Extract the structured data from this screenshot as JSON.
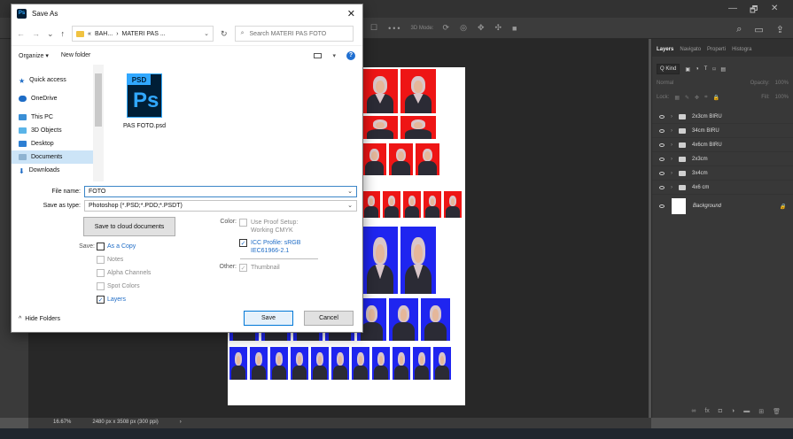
{
  "dialog": {
    "title": "Save As",
    "breadcrumb": {
      "prefix": "«",
      "parts": [
        "BAH...",
        "›",
        "MATERI PAS ..."
      ]
    },
    "search_placeholder": "Search MATERI PAS FOTO",
    "organize_label": "Organize ▾",
    "new_folder_label": "New folder",
    "nav": [
      {
        "label": "Quick access"
      },
      {
        "label": "OneDrive"
      },
      {
        "label": "This PC"
      },
      {
        "label": "3D Objects"
      },
      {
        "label": "Desktop"
      },
      {
        "label": "Documents"
      },
      {
        "label": "Downloads"
      }
    ],
    "file": {
      "name": "PAS FOTO.psd",
      "icon_tag": "PSD",
      "icon_text": "Ps"
    },
    "file_name_label": "File name:",
    "file_name_value": "FOTO",
    "save_as_type_label": "Save as type:",
    "save_as_type_value": "Photoshop (*.PSD;*.PDD;*.PSDT)",
    "save_to_cloud": "Save to cloud documents",
    "save_label": "Save:",
    "as_a_copy": "As a Copy",
    "notes": "Notes",
    "alpha_channels": "Alpha Channels",
    "spot_colors": "Spot Colors",
    "layers": "Layers",
    "color_label": "Color:",
    "use_proof_1": "Use Proof Setup:",
    "use_proof_2": "Working CMYK",
    "icc_1": "ICC Profile:  sRGB",
    "icc_2": "IEC61966-2.1",
    "other_label": "Other:",
    "thumbnail": "Thumbnail",
    "hide_folders": "Hide Folders",
    "save_button": "Save",
    "cancel_button": "Cancel",
    "close_symbol": "✕"
  },
  "photoshop": {
    "window_controls": [
      "—",
      "🗗",
      "✕"
    ],
    "options_icons": [
      "☐",
      "•••"
    ],
    "mode_label": "3D Mode:",
    "panel_tabs": [
      "Layers",
      "Navigato",
      "Properti",
      "Histogra"
    ],
    "kind_label": "Q Kind",
    "blend_mode": "Normal",
    "opacity_label": "Opacity:",
    "opacity_value": "100%",
    "lock_label": "Lock:",
    "fill_label": "Fill:",
    "fill_value": "100%",
    "layers": [
      "2x3cm BIRU",
      "34cm BIRU",
      "4x6cm BIRU",
      "2x3cm",
      "3x4cm",
      "4x6 cm"
    ],
    "background_layer": "Background",
    "zoom": "16.67%",
    "doc_size": "2480 px x 3508 px (300 ppi)",
    "status_arrow": "›"
  }
}
